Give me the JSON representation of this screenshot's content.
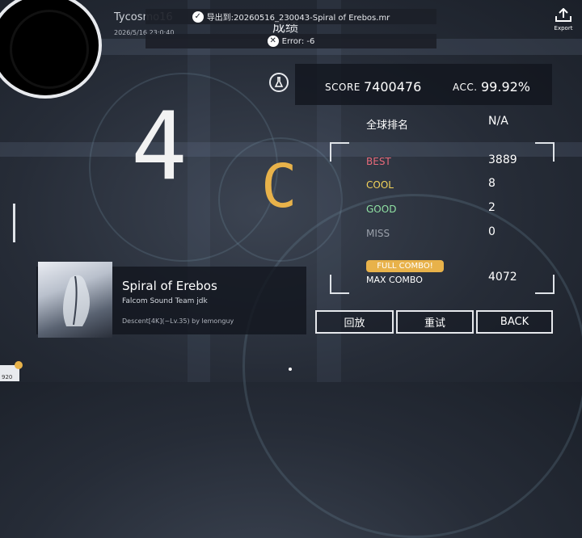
{
  "player": {
    "name": "Tycosmo16",
    "datetime": "2026/5/16 23:0:40"
  },
  "toasts": {
    "export": "导出到:20260516_230043-Spiral of Erebos.mr",
    "error": "Error: -6"
  },
  "header": {
    "title": "成绩",
    "export_label": "Export"
  },
  "score": {
    "score_label": "SCORE",
    "score_value": "7400476",
    "acc_label": "ACC.",
    "acc_value": "99.92%"
  },
  "rank": {
    "label": "全球排名",
    "value": "N/A"
  },
  "grade": {
    "big_number": "4",
    "letter": "C"
  },
  "judgements": [
    {
      "label": "BEST",
      "value": "3889",
      "color": "#e86a7a"
    },
    {
      "label": "COOL",
      "value": "8",
      "color": "#f3d35a"
    },
    {
      "label": "GOOD",
      "value": "2",
      "color": "#8fe0a3"
    },
    {
      "label": "MISS",
      "value": "0",
      "color": "#9aa0aa"
    }
  ],
  "combo": {
    "badge": "FULL COMBO!",
    "label": "MAX COMBO",
    "value": "4072"
  },
  "song": {
    "title": "Spiral of Erebos",
    "artist": "Falcom Sound Team jdk",
    "chart": "Descent[4K](~Lv.35) by lemonguy"
  },
  "buttons": {
    "replay": "回放",
    "retry": "重试",
    "back": "BACK"
  },
  "corner_badge": "920",
  "colors": {
    "accent_gold": "#e8b24a",
    "panel": "#12161e"
  }
}
